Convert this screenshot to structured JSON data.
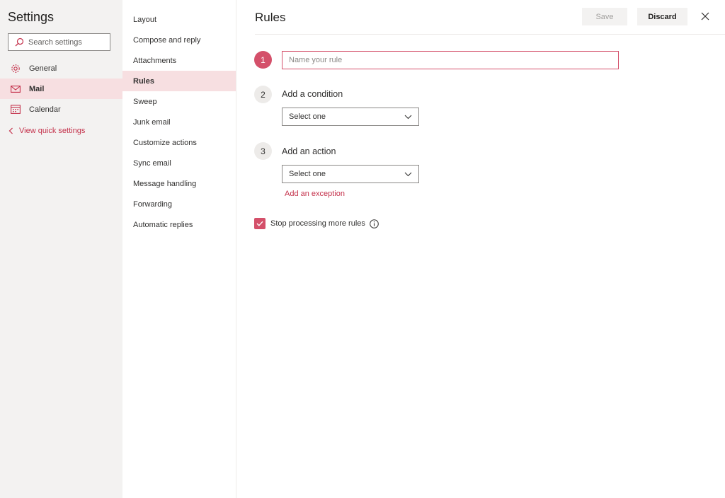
{
  "settings": {
    "title": "Settings",
    "search_placeholder": "Search settings",
    "categories": [
      {
        "label": "General",
        "icon": "gear-icon"
      },
      {
        "label": "Mail",
        "icon": "mail-icon",
        "active": true
      },
      {
        "label": "Calendar",
        "icon": "calendar-icon"
      }
    ],
    "quick_settings_label": "View quick settings"
  },
  "mail_nav": {
    "items": [
      {
        "label": "Layout"
      },
      {
        "label": "Compose and reply"
      },
      {
        "label": "Attachments"
      },
      {
        "label": "Rules",
        "active": true
      },
      {
        "label": "Sweep"
      },
      {
        "label": "Junk email"
      },
      {
        "label": "Customize actions"
      },
      {
        "label": "Sync email"
      },
      {
        "label": "Message handling"
      },
      {
        "label": "Forwarding"
      },
      {
        "label": "Automatic replies"
      }
    ]
  },
  "header": {
    "title": "Rules",
    "save_label": "Save",
    "discard_label": "Discard",
    "close_icon": "close-icon"
  },
  "form": {
    "steps": [
      {
        "number": "1",
        "placeholder": "Name your rule"
      },
      {
        "number": "2",
        "label": "Add a condition",
        "select_value": "Select one"
      },
      {
        "number": "3",
        "label": "Add an action",
        "select_value": "Select one"
      }
    ],
    "exception_link": "Add an exception",
    "stop_processing_label": "Stop processing more rules",
    "stop_processing_checked": true
  },
  "colors": {
    "accent": "#d4506a",
    "link": "#c4314b",
    "selected_bg": "#f7dfe1",
    "sidebar_bg": "#f3f2f1"
  }
}
